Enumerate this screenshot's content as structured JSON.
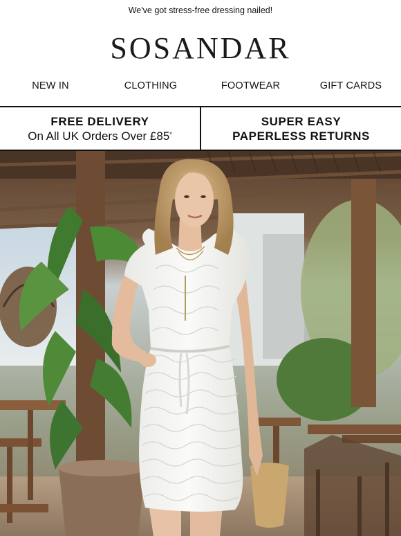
{
  "preheader": {
    "text": "We've got stress-free dressing nailed!"
  },
  "brand": {
    "logo_text": "SOSANDAR"
  },
  "nav": {
    "items": [
      {
        "label": "NEW IN"
      },
      {
        "label": "CLOTHING"
      },
      {
        "label": "FOOTWEAR"
      },
      {
        "label": "GIFT CARDS"
      }
    ]
  },
  "usp": {
    "left": {
      "line1": "FREE DELIVERY",
      "line2": "On All UK Orders Over £85",
      "mark": "*"
    },
    "right": {
      "line1": "SUPER EASY",
      "line2": "PAPERLESS RETURNS"
    }
  },
  "hero": {
    "image": "woman-in-white-textured-zip-dress-at-terrace-restaurant"
  },
  "colors": {
    "text": "#111111",
    "border": "#111111",
    "background": "#ffffff"
  }
}
